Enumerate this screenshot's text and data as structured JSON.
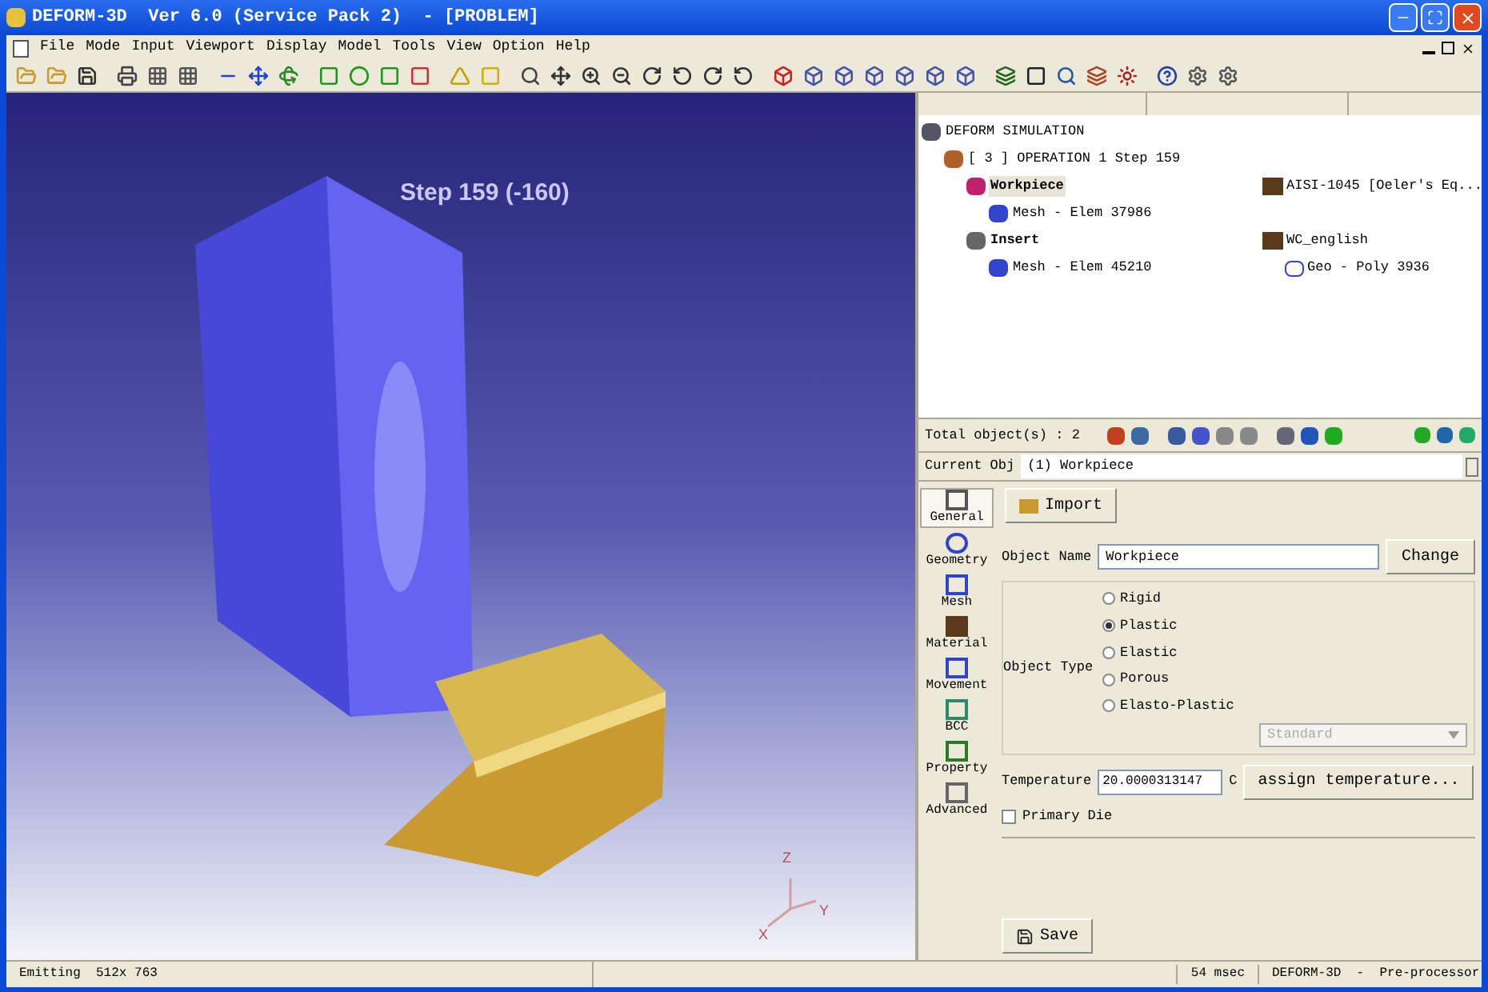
{
  "window": {
    "title": "DEFORM-3D  Ver 6.0 (Service Pack 2)  - [PROBLEM]"
  },
  "menu": [
    "File",
    "Mode",
    "Input",
    "Viewport",
    "Display",
    "Model",
    "Tools",
    "View",
    "Option",
    "Help"
  ],
  "viewport": {
    "step_label": "Step 159 (-160)",
    "axes": [
      "Z",
      "Y",
      "X"
    ]
  },
  "object_tree": [
    {
      "label": "DEFORM SIMULATION",
      "kind": "root",
      "children": [
        {
          "label": "[ 3 ]  OPERATION 1  Step 159",
          "kind": "operation",
          "children": [
            {
              "label": "Workpiece",
              "kind": "object",
              "selected": true,
              "value": {
                "text": "AISI-1045 [Oeler's Eq...",
                "kind": "material"
              },
              "children": [
                {
                  "label": "Mesh - Elem 37986",
                  "kind": "mesh"
                }
              ]
            },
            {
              "label": "Insert",
              "kind": "tool",
              "selected": false,
              "value": {
                "text": "WC_english",
                "kind": "material"
              },
              "children": [
                {
                  "label": "Mesh - Elem 45210",
                  "kind": "mesh",
                  "value": {
                    "text": "Geo - Poly 3936",
                    "kind": "geometry"
                  }
                }
              ]
            }
          ]
        }
      ]
    }
  ],
  "tree_footer": {
    "total": "Total object(s) : 2"
  },
  "current_object": {
    "label": "Current Obj",
    "value": "(1) Workpiece"
  },
  "side_tabs": [
    {
      "label": "General",
      "kind": "general",
      "selected": true
    },
    {
      "label": "Geometry",
      "kind": "geometry",
      "selected": false
    },
    {
      "label": "Mesh",
      "kind": "mesh",
      "selected": false
    },
    {
      "label": "Material",
      "kind": "material",
      "selected": false
    },
    {
      "label": "Movement",
      "kind": "movement",
      "selected": false
    },
    {
      "label": "BCC",
      "kind": "bcc",
      "selected": false
    },
    {
      "label": "Property",
      "kind": "property",
      "selected": false
    },
    {
      "label": "Advanced",
      "kind": "advanced",
      "selected": false
    }
  ],
  "general": {
    "import": "Import",
    "object_name_label": "Object Name",
    "object_name": "Workpiece",
    "change": "Change",
    "object_type_label": "Object Type",
    "types": [
      {
        "label": "Rigid",
        "selected": false
      },
      {
        "label": "Plastic",
        "selected": true
      },
      {
        "label": "Elastic",
        "selected": false
      },
      {
        "label": "Porous",
        "selected": false
      },
      {
        "label": "Elasto-Plastic",
        "selected": false
      }
    ],
    "model": {
      "value": "Standard",
      "disabled": true
    },
    "temperature_label": "Temperature",
    "temperature": "20.0000313147",
    "unit": "C",
    "assign": "assign temperature...",
    "primary_die": {
      "label": "Primary Die",
      "checked": false
    },
    "save": "Save"
  },
  "status_bar": {
    "left": "Emitting  512x 763",
    "time": "54 msec",
    "app": "DEFORM-3D  -  Pre-processor"
  }
}
